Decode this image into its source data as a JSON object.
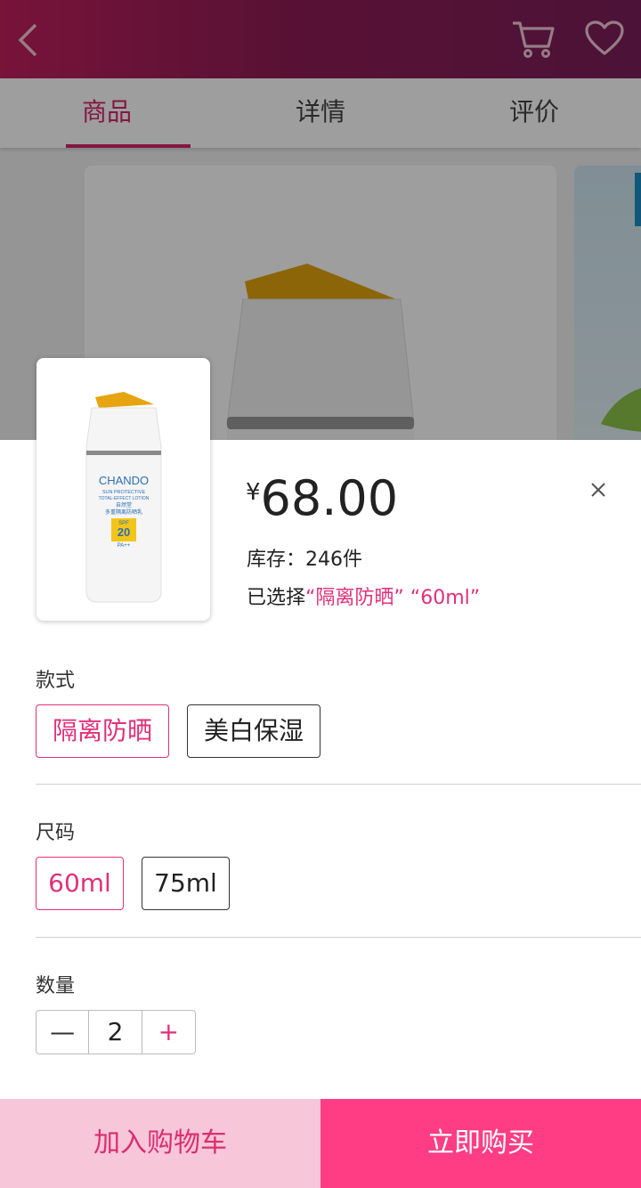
{
  "tabs": [
    {
      "label": "商品"
    },
    {
      "label": "详情"
    },
    {
      "label": "评价"
    }
  ],
  "product": {
    "currency": "¥",
    "price": "68.00",
    "stock": "库存：246件",
    "selected_prefix": "已选择",
    "selected_values": "“隔离防晒” “60ml”",
    "thumb_brand": "CHANDO",
    "thumb_sub1": "SUN PROTECTIVE",
    "thumb_sub2": "TOTAL-EFFECT LOTION",
    "thumb_cn1": "自然堂",
    "thumb_cn2": "多重隔离防晒乳",
    "thumb_spf": "SPF",
    "thumb_spf_num": "20",
    "thumb_pa": "PA++"
  },
  "style_section": {
    "label": "款式",
    "options": [
      {
        "label": "隔离防晒",
        "selected": true
      },
      {
        "label": "美白保湿",
        "selected": false
      }
    ]
  },
  "size_section": {
    "label": "尺码",
    "options": [
      {
        "label": "60ml",
        "selected": true
      },
      {
        "label": "75ml",
        "selected": false
      }
    ]
  },
  "quantity_section": {
    "label": "数量",
    "minus": "—",
    "value": "2",
    "plus": "+"
  },
  "actions": {
    "add_to_cart": "加入购物车",
    "buy_now": "立即购买"
  },
  "colors": {
    "accent": "#e0307a",
    "buy_bg": "#ff3d84",
    "cart_bg": "#f8c6d9",
    "header_start": "#c2205e",
    "header_end": "#7c1e5b"
  },
  "icons": [
    "back-arrow-icon",
    "cart-icon",
    "heart-icon",
    "close-icon"
  ]
}
